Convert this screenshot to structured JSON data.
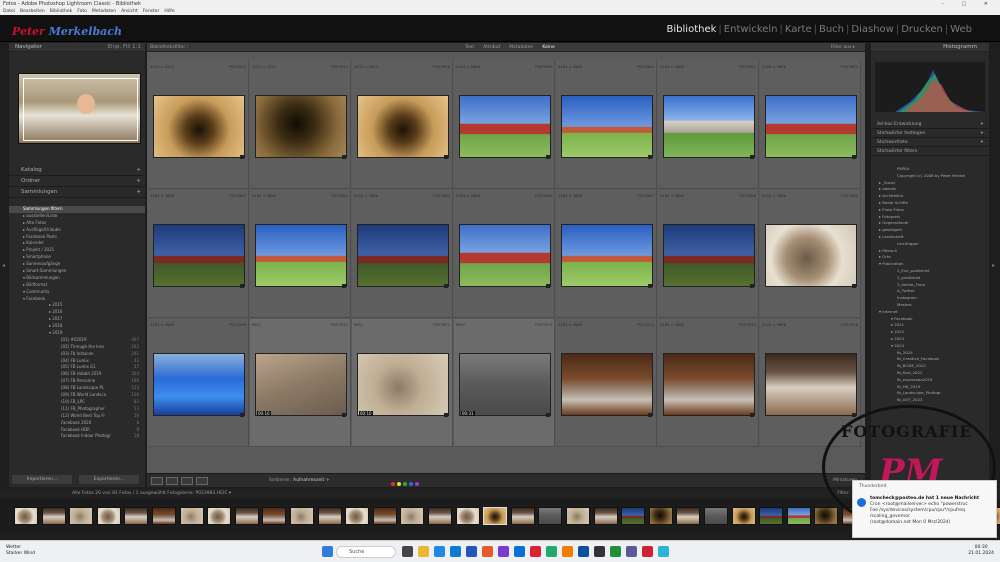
{
  "window": {
    "title": "Fotos - Adobe Photoshop Lightroom Classic - Bibliothek",
    "controls": "– ▢ ✕"
  },
  "menu": [
    "Datei",
    "Bearbeiten",
    "Bibliothek",
    "Foto",
    "Metadaten",
    "Ansicht",
    "Fenster",
    "Hilfe"
  ],
  "identity": {
    "logo_a": "Peter",
    "logo_b": "Merkelbach"
  },
  "modules": [
    "Bibliothek",
    "Entwickeln",
    "Karte",
    "Buch",
    "Diashow",
    "Drucken",
    "Web"
  ],
  "left": {
    "navigator": "Navigator",
    "nav_opts": "Einp.  Fill  1:1",
    "sections": [
      {
        "label": "Katalog"
      },
      {
        "label": "Ordner"
      },
      {
        "label": "Sammlungen"
      }
    ],
    "collections": [
      {
        "label": "Sammlungen filtern",
        "count": "",
        "sel": true
      },
      {
        "label": "▸ ausstellen/Liste",
        "count": ""
      },
      {
        "label": "▸ Alte Fotos",
        "count": ""
      },
      {
        "label": "▸ Ausflüge/Urlaube",
        "count": ""
      },
      {
        "label": "▸ Facebook Posts",
        "count": ""
      },
      {
        "label": "▸ Kalender",
        "count": ""
      },
      {
        "label": "▸ Projekt / 2021",
        "count": ""
      },
      {
        "label": "▸ Smartphone",
        "count": ""
      },
      {
        "label": "▸ Sonnenaufgänge",
        "count": ""
      },
      {
        "label": "▸ Smart-Sammlungen",
        "count": ""
      },
      {
        "label": "▾ Bildsammlungen",
        "count": ""
      },
      {
        "label": "▸ Bildformat",
        "count": ""
      },
      {
        "label": "▾ Community",
        "count": ""
      },
      {
        "label": "▾ Facebook",
        "count": ""
      },
      {
        "label": "▸ 2015",
        "count": ""
      },
      {
        "label": "▸ 2016",
        "count": ""
      },
      {
        "label": "▸ 2017",
        "count": ""
      },
      {
        "label": "▸ 2018",
        "count": ""
      },
      {
        "label": "▾ 2019",
        "count": ""
      },
      {
        "label": "(01) #02019",
        "count": "467"
      },
      {
        "label": "(02) Through the lens",
        "count": "163"
      },
      {
        "label": "(03) Fb Instacon",
        "count": "241"
      },
      {
        "label": "(04) FB Lumix",
        "count": "43"
      },
      {
        "label": "(05) FB Lumix G1",
        "count": "37"
      },
      {
        "label": "(06) FB Hobbit 2019",
        "count": "204"
      },
      {
        "label": "(07) FB Personne",
        "count": "196"
      },
      {
        "label": "(08) FB Landscape PL",
        "count": "123"
      },
      {
        "label": "(09) FB World Landsca",
        "count": "106"
      },
      {
        "label": "(10) FB_LPC",
        "count": "82"
      },
      {
        "label": "(11) FB_Photographer",
        "count": "53"
      },
      {
        "label": "(12) World Best Top Fr",
        "count": "16"
      },
      {
        "label": "Facebook 2020",
        "count": "8"
      },
      {
        "label": "Facebook HDR",
        "count": "8"
      },
      {
        "label": "Facebook Indoor Photogr",
        "count": "18"
      }
    ],
    "btn_import": "Importieren...",
    "btn_export": "Exportieren..."
  },
  "grid": {
    "breadcrumb": "Bibliotheksfilter :",
    "filters": [
      "Text",
      "Attribut",
      "Metadaten",
      "Keine"
    ],
    "active_filter": "Keine",
    "preset": "Filter aus ▸",
    "cells": [
      {
        "id": "P023955",
        "meta": "4032 x 3024",
        "thumb": "t-cave"
      },
      {
        "id": "P023930",
        "meta": "4032 x 3024",
        "thumb": "t-cave2"
      },
      {
        "id": "P023956",
        "meta": "4032 x 3024",
        "thumb": "t-cave"
      },
      {
        "id": "P023960",
        "meta": "5184 x 3888",
        "thumb": "t-church"
      },
      {
        "id": "P023960",
        "meta": "5184 x 3888",
        "thumb": "t-church2"
      },
      {
        "id": "P023961",
        "meta": "5184 x 3888",
        "thumb": "t-lane"
      },
      {
        "id": "P023962",
        "meta": "5184 x 3888",
        "thumb": "t-church"
      },
      {
        "id": "P023963",
        "meta": "5184 x 3888",
        "thumb": "t-dark"
      },
      {
        "id": "P023961",
        "meta": "5184 x 3888",
        "thumb": "t-church2"
      },
      {
        "id": "P023964",
        "meta": "5184 x 3888",
        "thumb": "t-dark"
      },
      {
        "id": "P023966",
        "meta": "5184 x 3888",
        "thumb": "t-church"
      },
      {
        "id": "P023967",
        "meta": "5184 x 3888",
        "thumb": "t-church2"
      },
      {
        "id": "P023968",
        "meta": "5184 x 3888",
        "thumb": "t-dark"
      },
      {
        "id": "P023969",
        "meta": "5184 x 3888",
        "thumb": "t-fire"
      },
      {
        "id": "P023999",
        "meta": "5184 x 3888",
        "thumb": "t-pool"
      },
      {
        "id": "P023970",
        "meta": "MOV",
        "thumb": "t-grey",
        "dur": "00:10",
        "dim": true
      },
      {
        "id": "P023972",
        "meta": "MOV",
        "thumb": "t-arch",
        "dur": "00:10",
        "dim": true
      },
      {
        "id": "P023973",
        "meta": "MOV",
        "thumb": "t-blur",
        "dur": "00:31",
        "dim": true
      },
      {
        "id": "P023974",
        "meta": "5184 x 3888",
        "thumb": "t-boots"
      },
      {
        "id": "P023975",
        "meta": "5184 x 3888",
        "thumb": "t-boots"
      },
      {
        "id": "P023976",
        "meta": "5184 x 3888",
        "thumb": "t-room"
      }
    ]
  },
  "toolbar": {
    "sort_label": "Sortieren:",
    "sort_value": "Aufnahmezeit ÷",
    "thumbs_label": "Miniaturen"
  },
  "right": {
    "histogram": "Histogramm",
    "histo_info": "Ad-hoc-Entwicklung",
    "quick": "Ad-hoc-Entwicklung",
    "keywording": "Stichwörter festlegen",
    "keyword_list": "Stichwortliste",
    "filter_kw": "Stichwörter filtern",
    "keywords": [
      {
        "label": "PAPKA",
        "count": ""
      },
      {
        "label": "Copyright (c) 2008 by Peter Merkel",
        "count": ""
      },
      {
        "label": "▸ _Kunst",
        "count": ""
      },
      {
        "label": "▸ abends",
        "count": ""
      },
      {
        "label": "▸ Architektur",
        "count": ""
      },
      {
        "label": "▸ Boote Schiffe",
        "count": ""
      },
      {
        "label": "▸ Erste Fotos",
        "count": ""
      },
      {
        "label": "▸ Fotopreis",
        "count": ""
      },
      {
        "label": "▸ Gegenstände",
        "count": ""
      },
      {
        "label": "▸ gesteigert",
        "count": ""
      },
      {
        "label": "▸ Landschaft",
        "count": ""
      },
      {
        "label": "Leichtigger",
        "count": ""
      },
      {
        "label": "▸ Mensch",
        "count": ""
      },
      {
        "label": "▸ Orte",
        "count": ""
      },
      {
        "label": "▾ Publication",
        "count": ""
      },
      {
        "label": "1_Eve_published",
        "count": ""
      },
      {
        "label": "2_published",
        "count": ""
      },
      {
        "label": "3_dolete_From",
        "count": ""
      },
      {
        "label": "A_Twitter",
        "count": ""
      },
      {
        "label": "Instagram",
        "count": ""
      },
      {
        "label": "Mastert",
        "count": ""
      },
      {
        "label": "▾ Internet",
        "count": ""
      },
      {
        "label": "▾ Facebook",
        "count": ""
      },
      {
        "label": "▸ 2021",
        "count": ""
      },
      {
        "label": "▸ 2022",
        "count": ""
      },
      {
        "label": "▸ 2023",
        "count": ""
      },
      {
        "label": "▾ 2024",
        "count": ""
      },
      {
        "label": "fb_2024",
        "count": ""
      },
      {
        "label": "fb_Creative_Facebook",
        "count": ""
      },
      {
        "label": "fb_BODE_2022",
        "count": ""
      },
      {
        "label": "fb_Kosi_2022",
        "count": ""
      },
      {
        "label": "fb_expresseo2019",
        "count": ""
      },
      {
        "label": "fb_HK_2019",
        "count": ""
      },
      {
        "label": "fb_Landscape_Photogr",
        "count": ""
      },
      {
        "label": "fb_AUT_2023",
        "count": ""
      }
    ]
  },
  "filmstrip": {
    "info": "Alle Fotos   20 von 81 Fotos / 1 ausgewählt  Fotogalerie: P023983.HEIC ▾",
    "filter": "Filter:",
    "thumbs": [
      "t-fire",
      "t-room",
      "t-arch",
      "t-fire",
      "t-room",
      "t-boots",
      "t-arch",
      "t-fire",
      "t-room",
      "t-boots",
      "t-arch",
      "t-room",
      "t-fire",
      "t-boots",
      "t-arch",
      "t-room",
      "t-fire",
      "t-cave",
      "t-room",
      "t-blur",
      "t-arch",
      "t-room",
      "t-dark",
      "t-cave2",
      "t-room",
      "t-blur",
      "t-cave",
      "t-dark",
      "t-church",
      "t-cave2",
      "t-boots",
      "t-room",
      "t-pool",
      "t-dark",
      "t-fire",
      "t-cave"
    ]
  },
  "toast": {
    "app": "Thunderbird",
    "title": "tomcheck@posteo.de hat 1 neue Nachricht",
    "line1": "Cron <root@mailserver> echo \"powerstruc",
    "line2": "Fee /sys/devices/system/cpu/cpu*/cpufreq",
    "line3": "/scaling_governor",
    "line4": "(root@domain.net Mon 0 Mrz/2024)"
  },
  "watermark": {
    "text": "FOTOGRAFIE",
    "mono": "PM"
  },
  "taskbar": {
    "weather_title": "Wetter",
    "weather_sub": "Starker Wind",
    "search": "Suche",
    "time": "00:30",
    "date": "21.01.2024"
  }
}
